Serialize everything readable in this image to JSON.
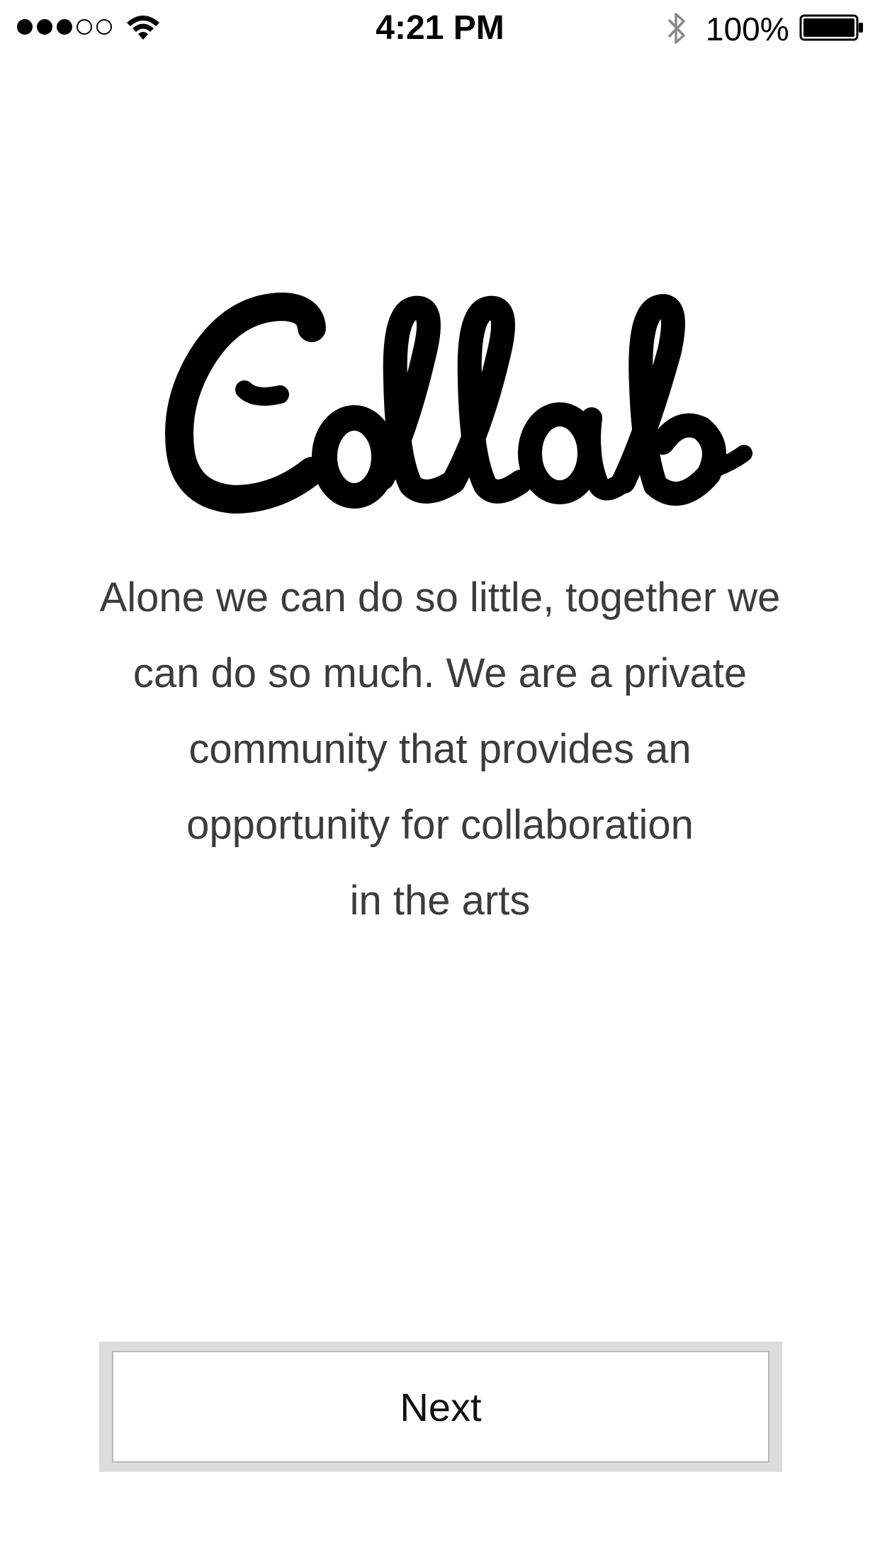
{
  "status_bar": {
    "signal_bars_filled": 3,
    "signal_bars_total": 5,
    "wifi_icon": "wifi-icon",
    "time": "4:21 PM",
    "bluetooth_icon": "bluetooth-icon",
    "battery_percent": "100%",
    "battery_icon": "battery-full-icon"
  },
  "logo": {
    "text": "Collab"
  },
  "tagline": {
    "lines": [
      "Alone we can do so little, together we",
      "can do so much. We are a private",
      "community that provides an",
      "opportunity for collaboration",
      "in the arts"
    ]
  },
  "actions": {
    "next_label": "Next"
  },
  "colors": {
    "background": "#ffffff",
    "text": "#3c3c3c",
    "button_frame": "#dcdcdc",
    "button_border": "#b8b8b8"
  }
}
